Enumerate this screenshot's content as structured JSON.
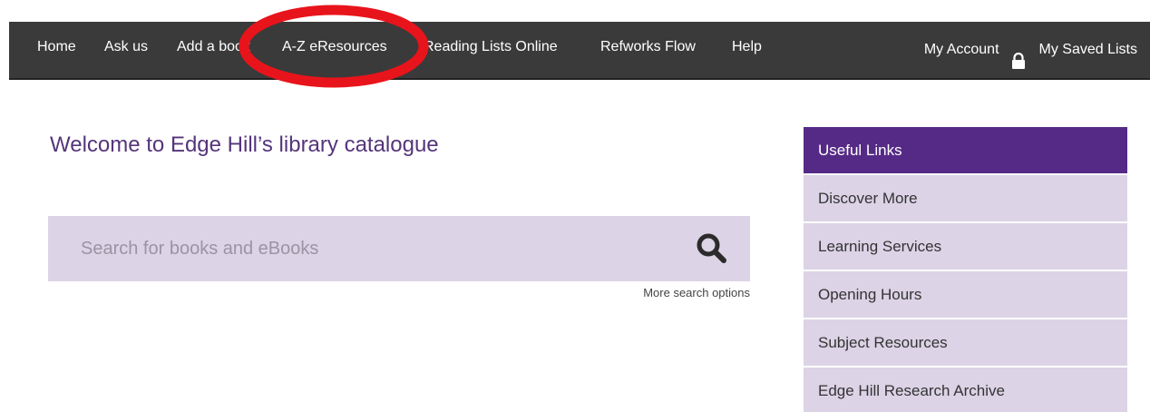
{
  "nav": {
    "items": [
      {
        "label": "Home"
      },
      {
        "label": "Ask us"
      },
      {
        "label": "Add a book"
      },
      {
        "label": "A-Z eResources"
      },
      {
        "label": "Reading Lists Online"
      },
      {
        "label": "Refworks Flow"
      },
      {
        "label": "Help"
      }
    ],
    "my_account": "My Account",
    "my_saved_lists": "My Saved Lists"
  },
  "annotation": {
    "ring_color": "#e8141b",
    "ring_target": "A-Z eResources"
  },
  "main": {
    "title": "Welcome to Edge Hill’s library catalogue",
    "search_placeholder": "Search for books and eBooks",
    "more_search_options": "More search options"
  },
  "sidebar": {
    "header": "Useful Links",
    "links": [
      {
        "label": "Discover More"
      },
      {
        "label": "Learning Services"
      },
      {
        "label": "Opening Hours"
      },
      {
        "label": "Subject Resources"
      },
      {
        "label": "Edge Hill Research Archive"
      }
    ]
  },
  "colors": {
    "nav_bg": "#3a3a3a",
    "brand_purple": "#552a86",
    "light_purple": "#dcd3e6",
    "title_color": "#55357a"
  },
  "icons": {
    "search": "search-icon",
    "lock": "lock-icon"
  }
}
